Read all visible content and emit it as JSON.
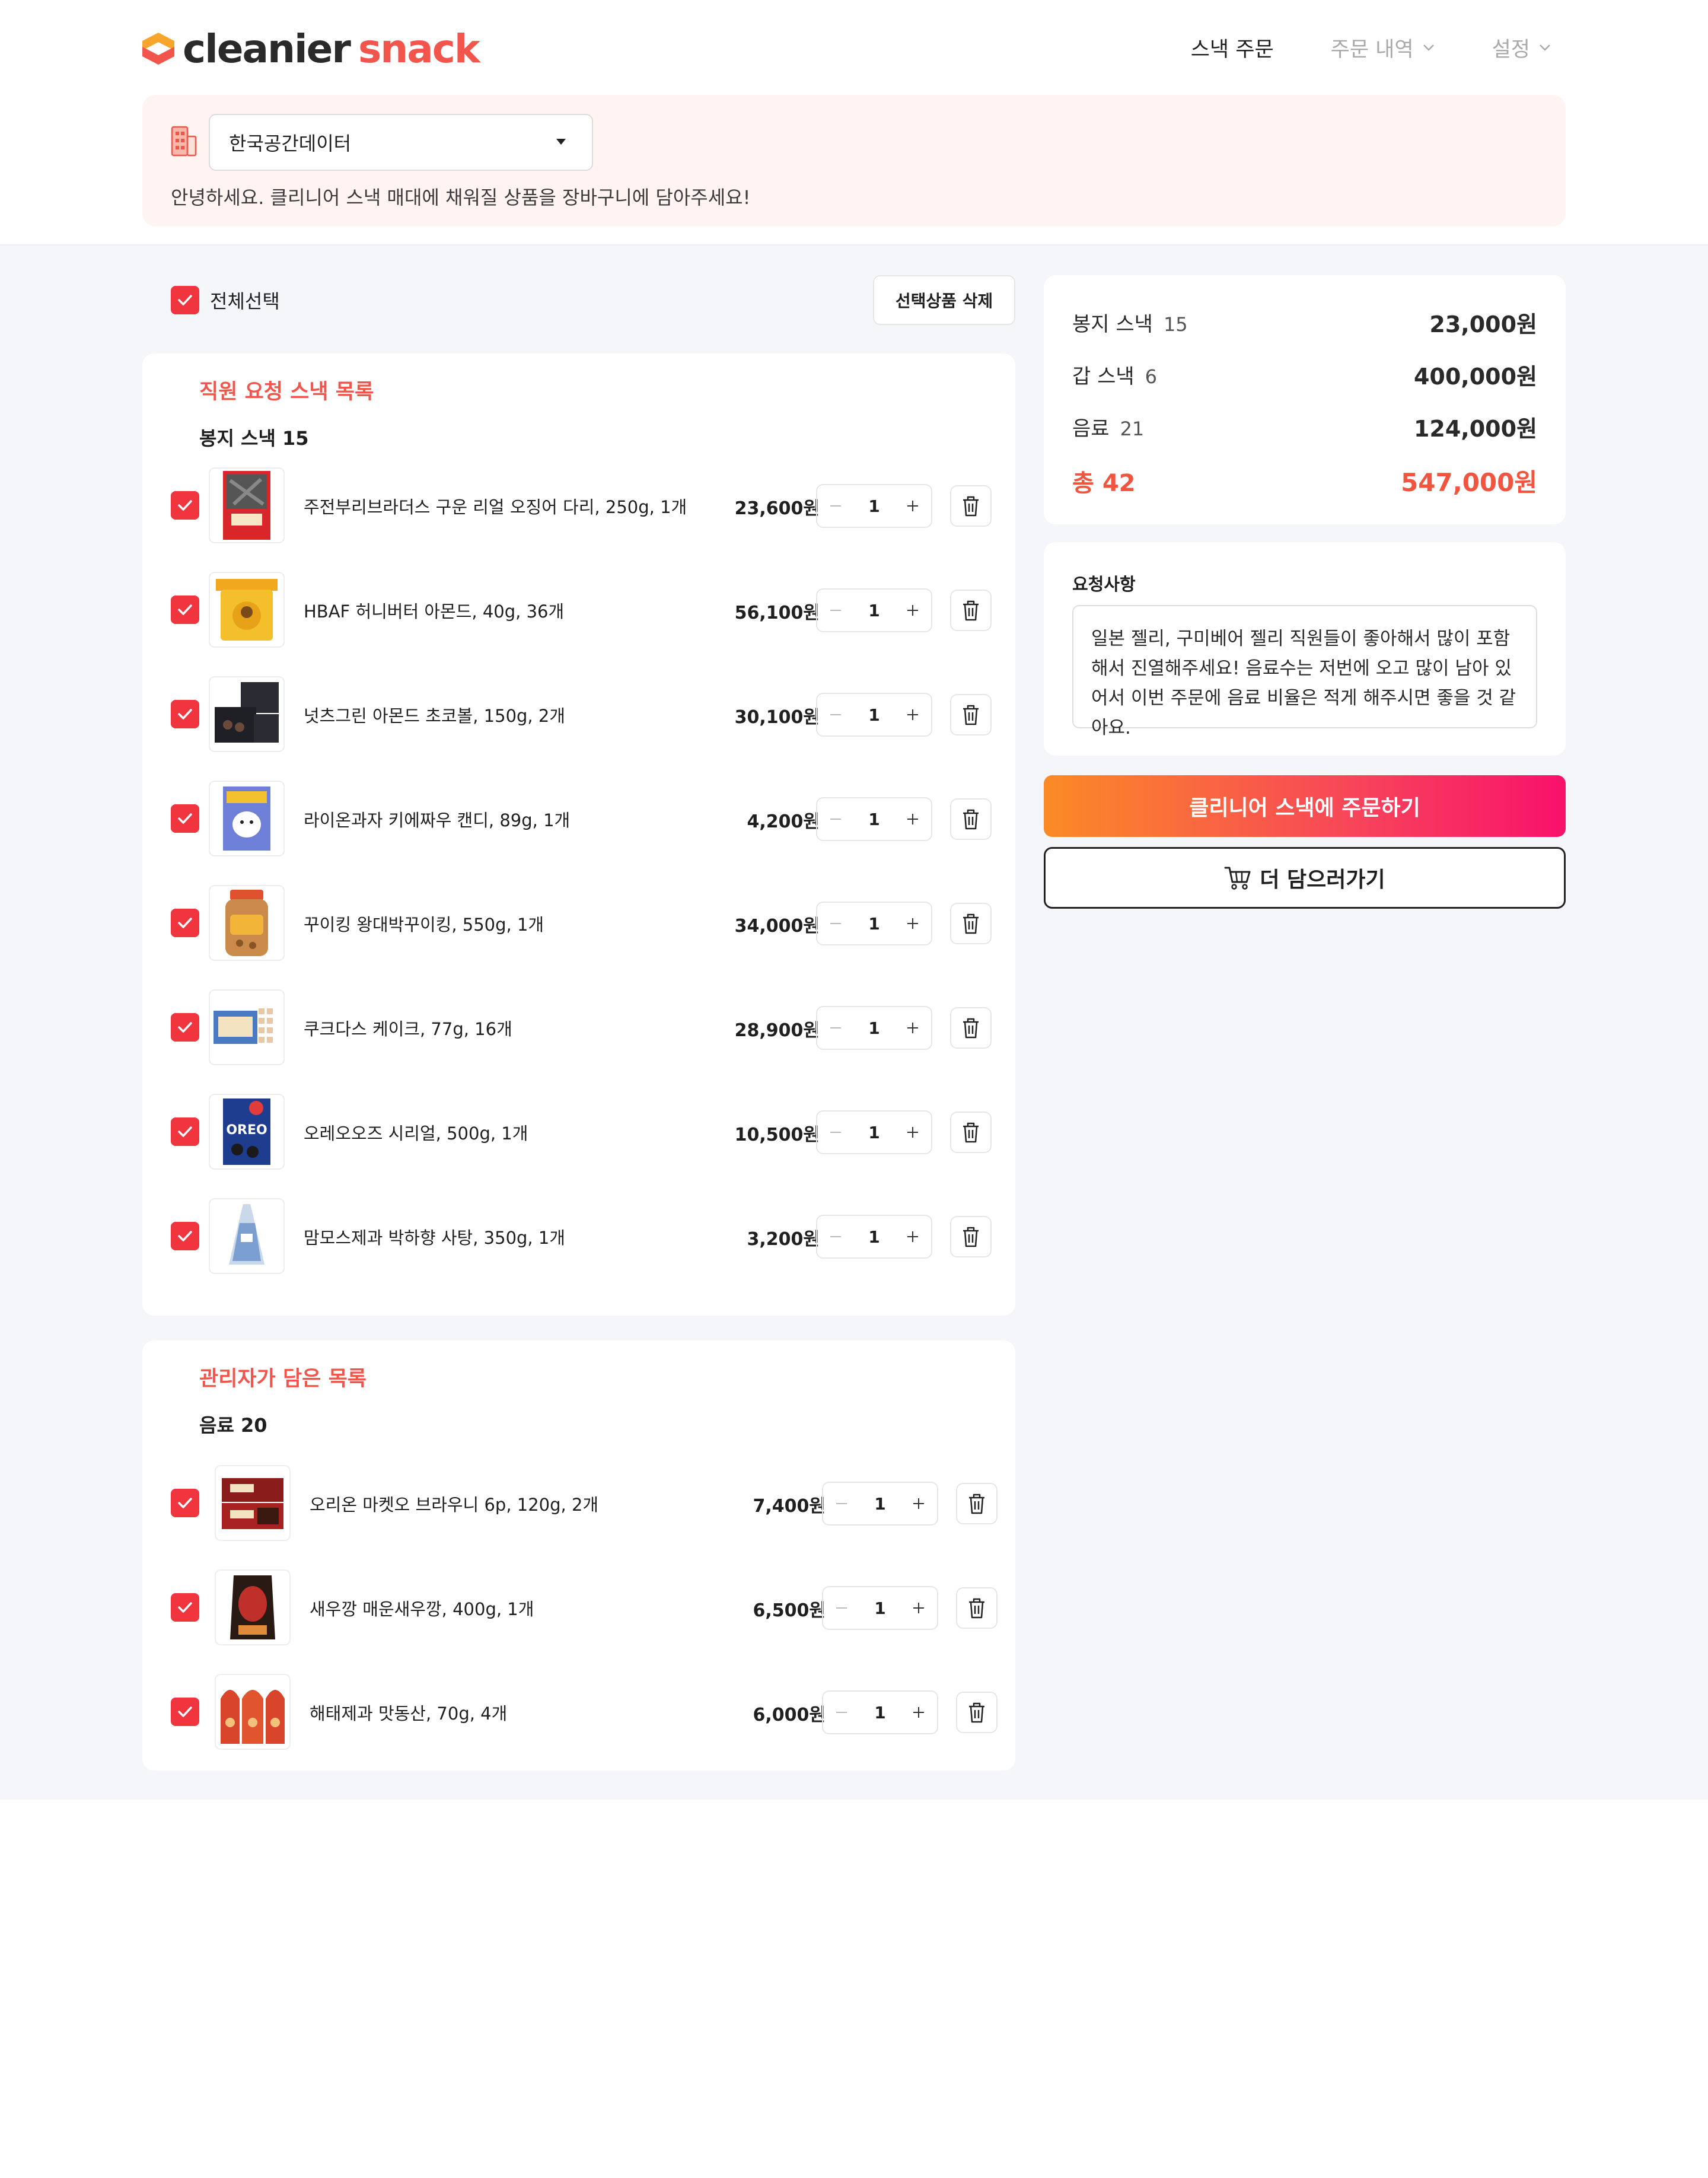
{
  "header": {
    "logo_part1": "cleanier",
    "logo_part2": "snack",
    "nav": [
      {
        "label": "스낵 주문"
      },
      {
        "label": "주문 내역"
      },
      {
        "label": "설정"
      }
    ]
  },
  "notice": {
    "company": "한국공간데이터",
    "message": "안녕하세요. 클리니어 스낵 매대에 채워질 상품을 장바구니에 담아주세요!"
  },
  "toolbar": {
    "select_all_label": "전체선택",
    "delete_selected_label": "선택상품 삭제"
  },
  "employee_section": {
    "title": "직원 요청 스낵 목록",
    "category": "봉지 스낵 15",
    "items": [
      {
        "name": "주전부리브라더스 구운 리얼 오징어 다리, 250g, 1개",
        "price": "23,600원",
        "qty": "1"
      },
      {
        "name": "HBAF 허니버터 아몬드, 40g, 36개",
        "price": "56,100원",
        "qty": "1"
      },
      {
        "name": "넛츠그린 아몬드 초코볼, 150g, 2개",
        "price": "30,100원",
        "qty": "1"
      },
      {
        "name": "라이온과자 키에짜우 캔디, 89g, 1개",
        "price": "4,200원",
        "qty": "1"
      },
      {
        "name": "꾸이킹 왕대박꾸이킹, 550g, 1개",
        "price": "34,000원",
        "qty": "1"
      },
      {
        "name": "쿠크다스 케이크, 77g, 16개",
        "price": "28,900원",
        "qty": "1"
      },
      {
        "name": "오레오오즈 시리얼, 500g, 1개",
        "price": "10,500원",
        "qty": "1"
      },
      {
        "name": "맘모스제과 박하향 사탕, 350g, 1개",
        "price": "3,200원",
        "qty": "1"
      }
    ]
  },
  "admin_section": {
    "title": "관리자가 담은 목록",
    "category": "음료 20",
    "items": [
      {
        "name": "오리온 마켓오 브라우니 6p, 120g, 2개",
        "price": "7,400원",
        "qty": "1"
      },
      {
        "name": "새우깡 매운새우깡, 400g, 1개",
        "price": "6,500원",
        "qty": "1"
      },
      {
        "name": "해태제과 맛동산, 70g, 4개",
        "price": "6,000원",
        "qty": "1"
      }
    ]
  },
  "summary": {
    "rows": [
      {
        "label": "봉지 스낵",
        "count": "15",
        "value": "23,000원"
      },
      {
        "label": "갑 스낵",
        "count": "6",
        "value": "400,000원"
      },
      {
        "label": "음료",
        "count": "21",
        "value": "124,000원"
      }
    ],
    "total_label": "총",
    "total_count": "42",
    "total_value": "547,000원"
  },
  "request": {
    "label": "요청사항",
    "text": "일본 젤리, 구미베어 젤리 직원들이 좋아해서 많이 포함해서 진열해주세요! 음료수는 저번에 오고 많이 남아 있어서 이번 주문에 음료 비율은 적게 해주시면 좋을 것 같아요."
  },
  "actions": {
    "order_label": "클리니어 스낵에 주문하기",
    "more_label": "더 담으러가기"
  },
  "colors": {
    "accent": "#f2554b",
    "checkbox": "#f0353f",
    "order_gradient_start": "#fb8b25",
    "order_gradient_end": "#f8116b",
    "page_bg": "#f5f6fa"
  },
  "icons": [
    "logo-mark-icon",
    "building-icon",
    "chevron-down-icon",
    "checkbox-check-icon",
    "minus-icon",
    "plus-icon",
    "trash-icon",
    "cart-icon"
  ]
}
